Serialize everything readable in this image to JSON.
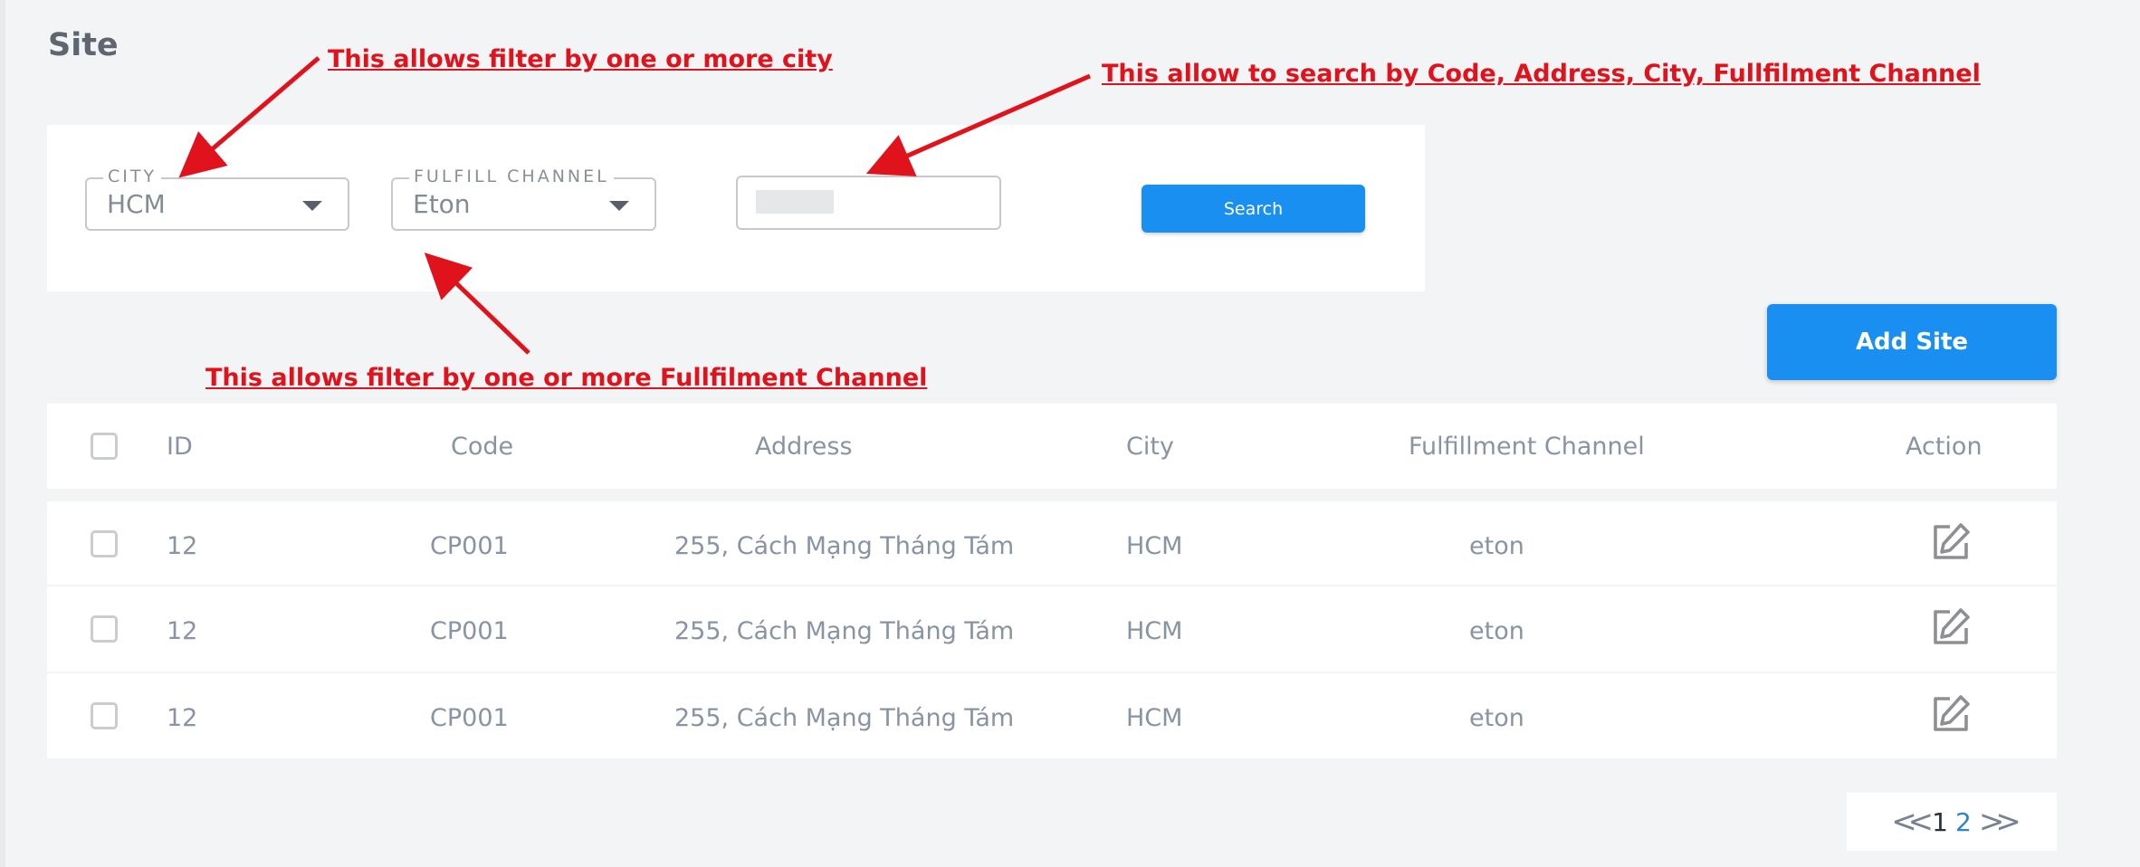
{
  "page": {
    "title": "Site"
  },
  "filters": {
    "city": {
      "label": "CITY",
      "value": "HCM"
    },
    "channel": {
      "label": "FULFILL CHANNEL",
      "value": "Eton"
    },
    "search": {
      "value": ""
    },
    "search_button": "Search"
  },
  "actions": {
    "add_site": "Add Site"
  },
  "table": {
    "headers": [
      "ID",
      "Code",
      "Address",
      "City",
      "Fulfillment Channel",
      "Action"
    ],
    "rows": [
      {
        "id": "12",
        "code": "CP001",
        "address": "255, Cách Mạng Tháng Tám",
        "city": "HCM",
        "channel": "eton"
      },
      {
        "id": "12",
        "code": "CP001",
        "address": "255, Cách Mạng Tháng Tám",
        "city": "HCM",
        "channel": "eton"
      },
      {
        "id": "12",
        "code": "CP001",
        "address": "255, Cách Mạng Tháng Tám",
        "city": "HCM",
        "channel": "eton"
      }
    ]
  },
  "pagination": {
    "prev": "<<",
    "pages": [
      "1",
      "2"
    ],
    "next": ">>"
  },
  "annotations": {
    "city": "This allows filter by one or more city",
    "search": "This allow to search by Code, Address, City, Fullfilment Channel",
    "channel": "This allows filter by one or more Fullfilment Channel"
  },
  "colors": {
    "accent": "#1a8ff2",
    "annotation": "#e0121b",
    "background": "#f3f4f6"
  }
}
